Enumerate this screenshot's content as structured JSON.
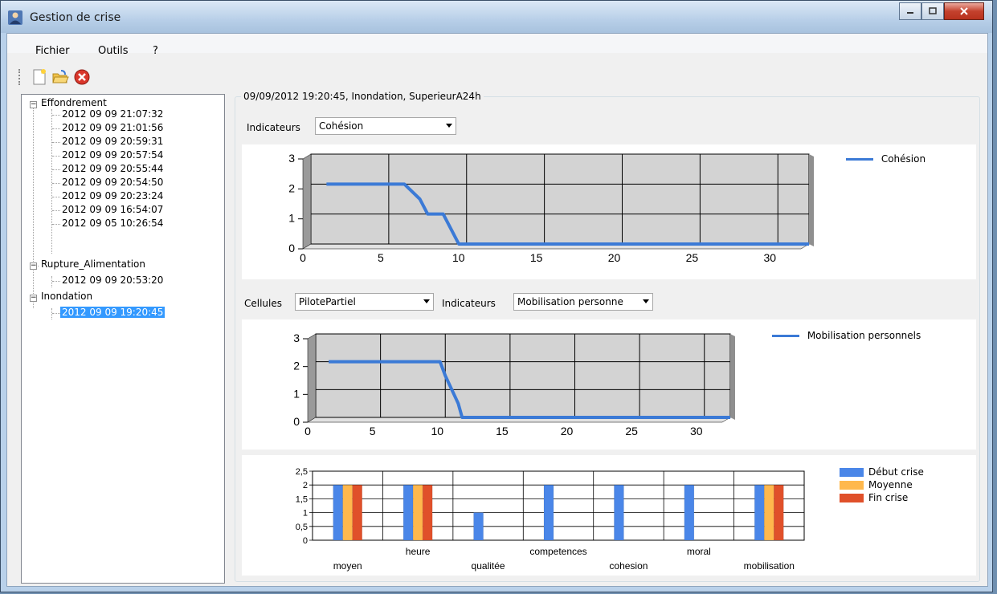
{
  "window": {
    "title": "Gestion de crise"
  },
  "menu": {
    "fichier": "Fichier",
    "outils": "Outils",
    "help": "?"
  },
  "toolbar": {
    "new_icon": "new-document-icon",
    "open_icon": "open-folder-icon",
    "close_icon": "close-red-icon"
  },
  "tree": {
    "groups": [
      {
        "label": "Effondrement",
        "items": [
          "2012 09 09 21:07:32",
          "2012 09 09 21:01:56",
          "2012 09 09 20:59:31",
          "2012 09 09 20:57:54",
          "2012 09 09 20:55:44",
          "2012 09 09 20:54:50",
          "2012 09 09 20:23:24",
          "2012 09 09 16:54:07",
          "2012 09 05 10:26:54"
        ]
      },
      {
        "label": "Rupture_Alimentation",
        "items": [
          "2012 09 09 20:53:20"
        ]
      },
      {
        "label": "Inondation",
        "items": [
          "2012 09 09 19:20:45"
        ]
      }
    ],
    "selected": "2012 09 09 19:20:45"
  },
  "panel": {
    "title": "09/09/2012 19:20:45, Inondation, SuperieurA24h",
    "indicateurs_label": "Indicateurs",
    "indicateurs_value": "Cohésion",
    "cellules_label": "Cellules",
    "cellules_value": "PilotePartiel",
    "indicateurs2_label": "Indicateurs",
    "indicateurs2_value": "Mobilisation personne"
  },
  "chart_data": [
    {
      "type": "line",
      "series": [
        {
          "name": "Cohésion",
          "x": [
            1,
            6,
            7,
            7.5,
            8,
            8.5,
            9,
            9.5,
            10,
            32
          ],
          "y": [
            2,
            2,
            1.5,
            1,
            1,
            1,
            0.5,
            0,
            0,
            0
          ]
        }
      ],
      "xticks": [
        0,
        5,
        10,
        15,
        20,
        25,
        30
      ],
      "yticks": [
        0,
        1,
        2,
        3
      ],
      "xlim": [
        0,
        32
      ],
      "ylim": [
        0,
        3
      ],
      "color": "#3b7ad6",
      "grid": true,
      "legend": "top-right"
    },
    {
      "type": "line",
      "series": [
        {
          "name": "Mobilisation personnels",
          "x": [
            1,
            9,
            9.6,
            10,
            10.5,
            11,
            11.3,
            32
          ],
          "y": [
            2,
            2,
            2,
            1.5,
            1,
            0.5,
            0,
            0
          ]
        }
      ],
      "xticks": [
        0,
        5,
        10,
        15,
        20,
        25,
        30
      ],
      "yticks": [
        0,
        1,
        2,
        3
      ],
      "xlim": [
        0,
        32
      ],
      "ylim": [
        0,
        3
      ],
      "color": "#3b7ad6",
      "grid": true,
      "legend": "top-right"
    },
    {
      "type": "bar",
      "categories": [
        "moyen",
        "heure",
        "qualitée",
        "competences",
        "cohesion",
        "moral",
        "mobilisation"
      ],
      "series": [
        {
          "name": "Début crise",
          "values": [
            2,
            2,
            1,
            2,
            2,
            2,
            2
          ],
          "color": "#4a86e8"
        },
        {
          "name": "Moyenne",
          "values": [
            2,
            2,
            0,
            0,
            0,
            0,
            2
          ],
          "color": "#ffb84d"
        },
        {
          "name": "Fin crise",
          "values": [
            2,
            2,
            0,
            0,
            0,
            0,
            2
          ],
          "color": "#e0502a"
        }
      ],
      "yticks": [
        "0",
        "0,5",
        "1",
        "1,5",
        "2",
        "2,5"
      ],
      "ylim": [
        0,
        2.5
      ],
      "grid": true,
      "legend": "top-right"
    }
  ]
}
